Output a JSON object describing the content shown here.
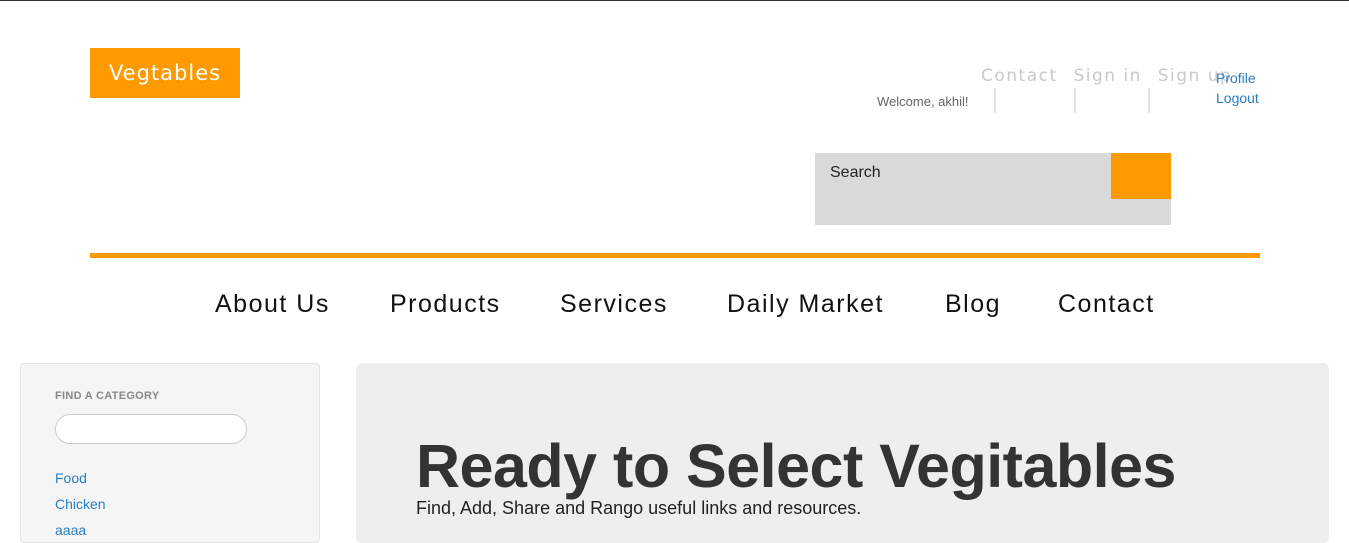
{
  "brand": {
    "logo_text": "Vegtables",
    "accent_color": "#ff9900"
  },
  "user_nav": {
    "contact": "Contact",
    "sign_in": "Sign in",
    "sign_up": "Sign up"
  },
  "account": {
    "welcome": "Welcome, akhil!",
    "profile": "Profile",
    "logout": "Logout"
  },
  "search": {
    "placeholder": "Search"
  },
  "main_nav": [
    "About Us",
    "Products",
    "Services",
    "Daily Market",
    "Blog",
    "Contact"
  ],
  "sidebar": {
    "heading": "FIND A CATEGORY",
    "categories": [
      "Food",
      "Chicken",
      "aaaa"
    ]
  },
  "hero": {
    "title": "Ready to Select Vegitables",
    "subtitle": "Find, Add, Share and Rango useful links and resources."
  }
}
